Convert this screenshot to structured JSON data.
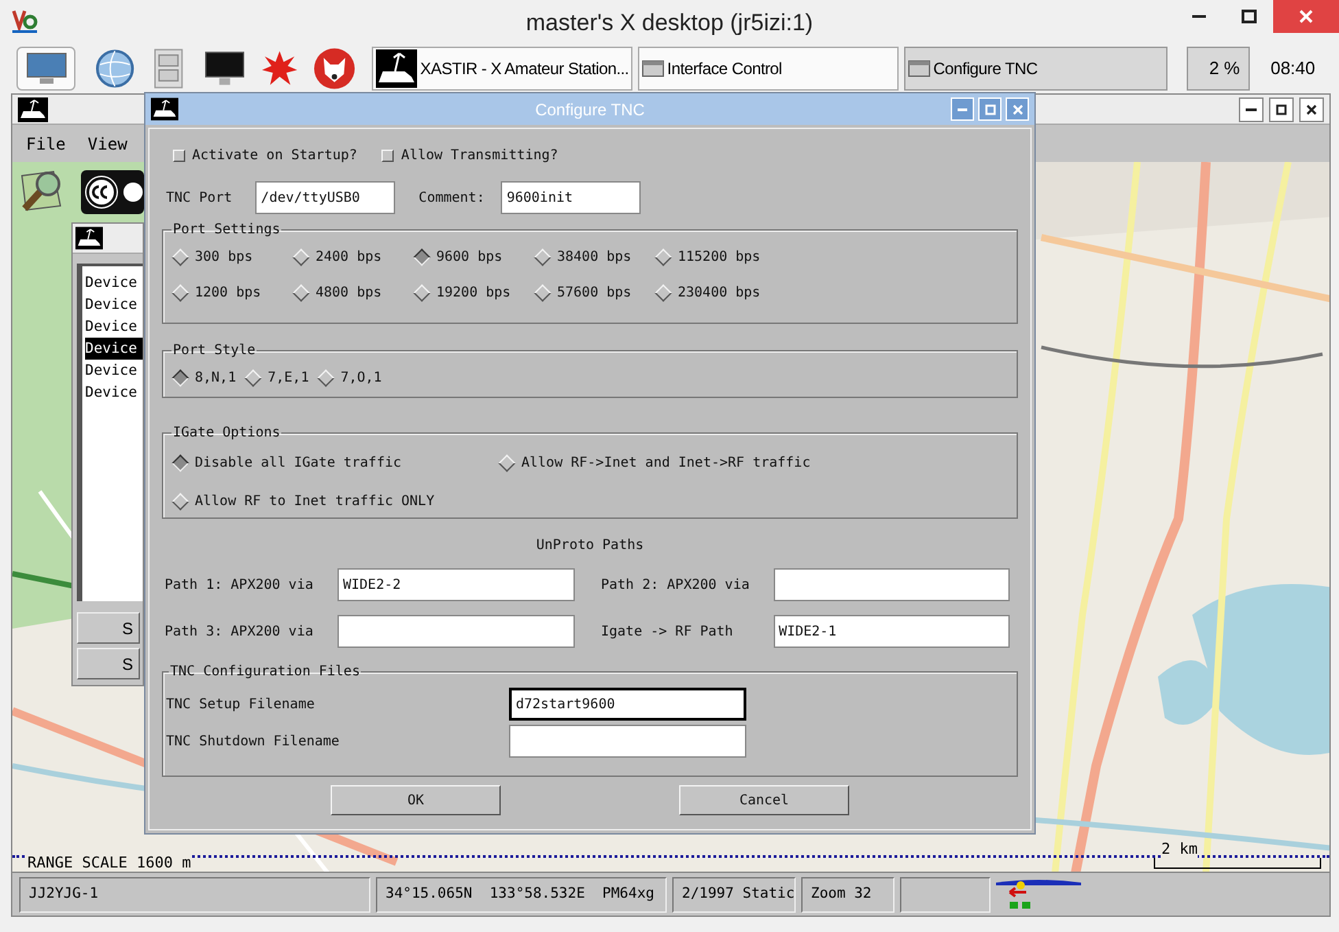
{
  "desktop": {
    "title": "master's X desktop (jr5izi:1)"
  },
  "taskbar": {
    "tasks": [
      {
        "label": "XASTIR - X Amateur Station...",
        "selected": false
      },
      {
        "label": "Interface Control",
        "selected": false
      },
      {
        "label": "Configure TNC",
        "selected": true
      }
    ],
    "cpu": "2 %",
    "clock": "08:40"
  },
  "main_window": {
    "menu": [
      "File",
      "View"
    ],
    "range_scale": "RANGE SCALE 1600 m",
    "scale_bar": "2 km",
    "status_bar": [
      "JJ2YJG-1",
      "34°15.065N  133°58.532E  PM64xg",
      "2/1997 Static",
      "Zoom 32"
    ]
  },
  "interface_control": {
    "devices": [
      {
        "label": "Device",
        "selected": false
      },
      {
        "label": "Device",
        "selected": false
      },
      {
        "label": "Device",
        "selected": false
      },
      {
        "label": "Device",
        "selected": true
      },
      {
        "label": "Device",
        "selected": false
      },
      {
        "label": "Device",
        "selected": false
      }
    ],
    "buttons": [
      "S",
      "S"
    ]
  },
  "dialog": {
    "title": "Configure TNC",
    "checkboxes": [
      {
        "label": "Activate on Startup?",
        "checked": false
      },
      {
        "label": "Allow Transmitting?",
        "checked": false
      }
    ],
    "fields": [
      {
        "label": "TNC Port",
        "value": "/dev/ttyUSB0"
      },
      {
        "label": "Comment:",
        "value": "9600init"
      }
    ],
    "port_settings": {
      "title": "Port Settings",
      "options": [
        {
          "label": "300 bps",
          "selected": false
        },
        {
          "label": "2400 bps",
          "selected": false
        },
        {
          "label": "9600 bps",
          "selected": true
        },
        {
          "label": "38400 bps",
          "selected": false
        },
        {
          "label": "115200 bps",
          "selected": false
        },
        {
          "label": "1200 bps",
          "selected": false
        },
        {
          "label": "4800 bps",
          "selected": false
        },
        {
          "label": "19200 bps",
          "selected": false
        },
        {
          "label": "57600 bps",
          "selected": false
        },
        {
          "label": "230400 bps",
          "selected": false
        }
      ]
    },
    "port_style": {
      "title": "Port Style",
      "options": [
        {
          "label": "8,N,1",
          "selected": true
        },
        {
          "label": "7,E,1",
          "selected": false
        },
        {
          "label": "7,O,1",
          "selected": false
        }
      ]
    },
    "igate_options": {
      "title": "IGate Options",
      "options": [
        {
          "label": "Disable all IGate traffic",
          "selected": true
        },
        {
          "label": "Allow RF->Inet and Inet->RF traffic",
          "selected": false
        },
        {
          "label": "Allow RF to Inet traffic ONLY",
          "selected": false
        }
      ]
    },
    "unproto": {
      "title": "UnProto Paths",
      "paths": [
        {
          "label": "Path 1: APX200 via",
          "value": "WIDE2-2"
        },
        {
          "label": "Path 2: APX200 via"
        },
        {
          "label": "Path 3: APX200 via"
        },
        {
          "label": "Igate -> RF Path",
          "value": "WIDE2-1"
        }
      ]
    },
    "config_files": {
      "title": "TNC Configuration Files",
      "files": [
        {
          "label": "TNC Setup Filename",
          "value": "d72start9600",
          "focused": true
        },
        {
          "label": "TNC Shutdown Filename",
          "focused": false
        }
      ]
    },
    "buttons": [
      "OK",
      "Cancel"
    ]
  }
}
